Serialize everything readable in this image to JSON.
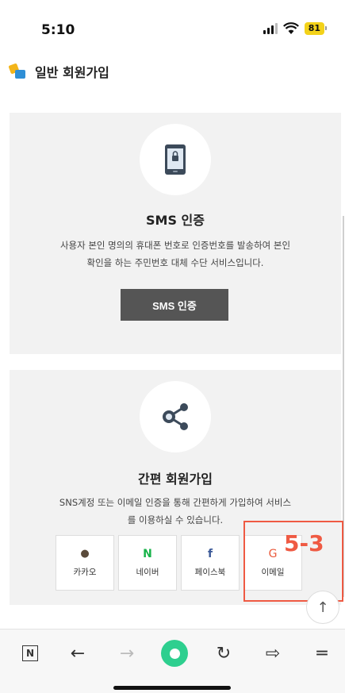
{
  "status": {
    "time": "5:10",
    "battery": "81",
    "icons": [
      "signal-icon",
      "wifi-icon",
      "battery-icon"
    ]
  },
  "header": {
    "title": "일반 회원가입",
    "icon": "member-signup-icon"
  },
  "sms_card": {
    "icon": "phone-lock-icon",
    "title": "SMS 인증",
    "desc_line1": "사용자 본인 명의의 휴대폰 번호로 인증번호를 발송하여 본인",
    "desc_line2": "확인을 하는 주민번호 대체 수단 서비스입니다.",
    "button": "SMS 인증"
  },
  "sns_card": {
    "icon": "share-icon",
    "title": "간편 회원가입",
    "desc_line1": "SNS계정 또는 이메일 인증을 통해 간편하게 가입하여 서비스",
    "desc_line2": "를 이용하실 수 있습니다.",
    "options": [
      {
        "label": "카카오",
        "icon": "💬",
        "color": "#5a4a3a"
      },
      {
        "label": "네이버",
        "icon": "N",
        "color": "#19b34a"
      },
      {
        "label": "페이스북",
        "icon": "f",
        "color": "#3b5998"
      },
      {
        "label": "이메일",
        "icon": "G",
        "color": "#ea5a3c"
      }
    ]
  },
  "annotation": {
    "label": "5-3",
    "color": "#ef5a43"
  },
  "scroll_top": {
    "icon": "↑"
  },
  "bottom_nav": {
    "n_icon": "N",
    "back": "←",
    "forward": "→",
    "reload": "↻",
    "share": "⇨",
    "menu": "═"
  }
}
